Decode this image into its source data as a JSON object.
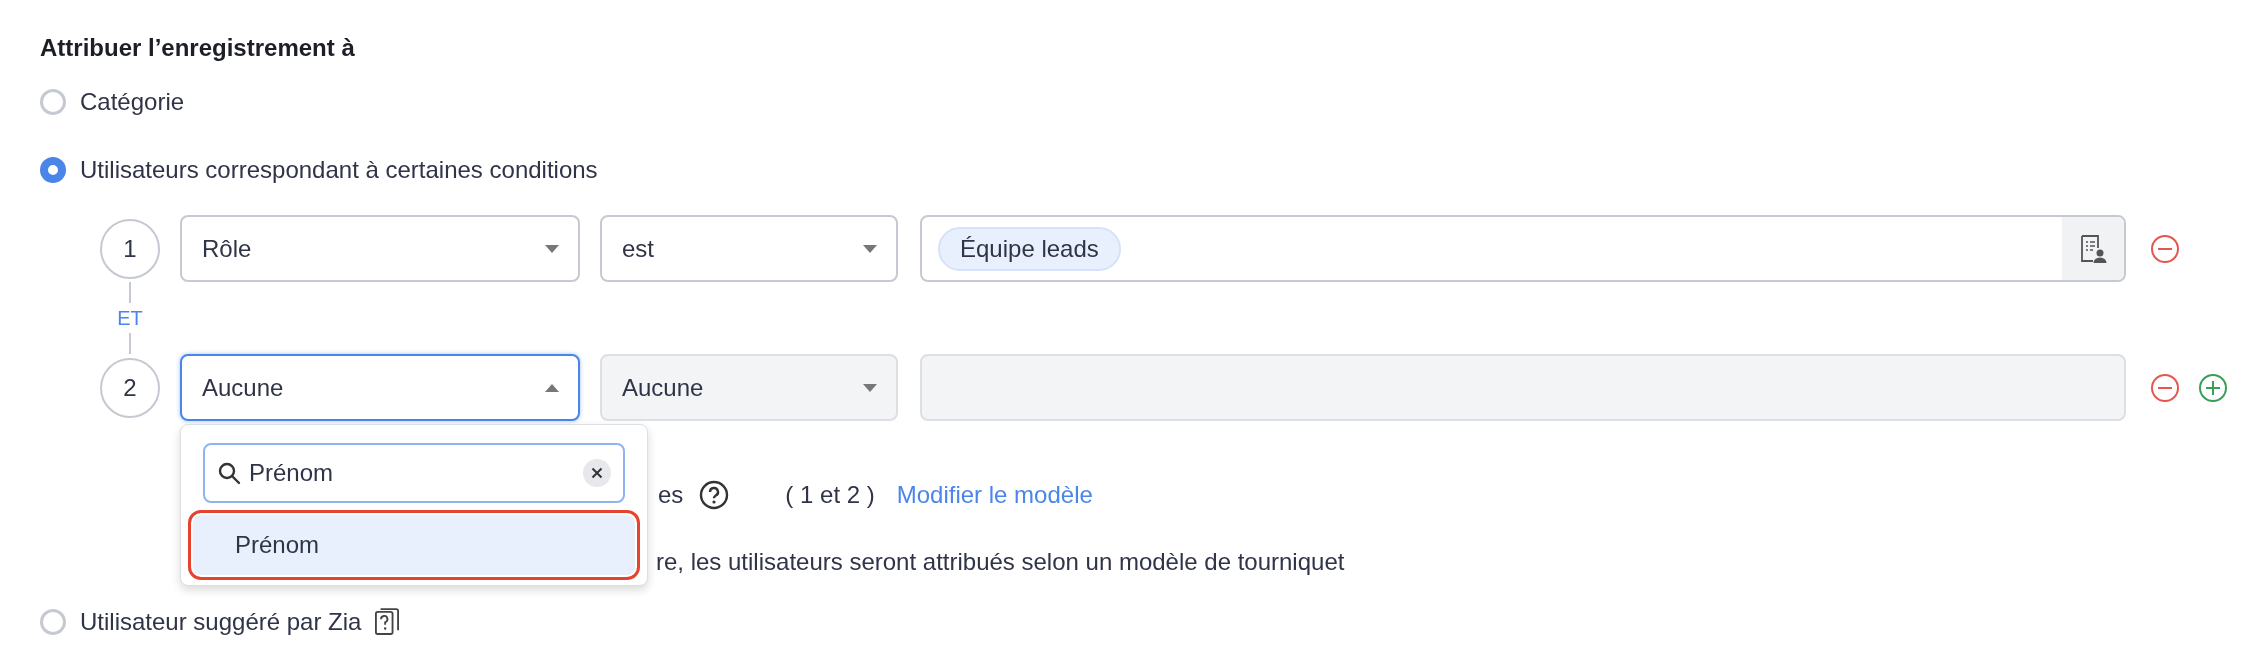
{
  "heading": "Attribuer l’enregistrement à",
  "options": [
    {
      "label": "Catégorie",
      "selected": false
    },
    {
      "label": "Utilisateurs correspondant à certaines conditions",
      "selected": true
    },
    {
      "label": "Utilisateur suggéré par Zia",
      "selected": false
    }
  ],
  "conditions": [
    {
      "number": "1",
      "field": "Rôle",
      "operator": "est",
      "values": [
        "Équipe leads"
      ],
      "disabled": false,
      "expanded": false,
      "can_add": false
    },
    {
      "number": "2",
      "field": "Aucune",
      "operator": "Aucune",
      "disabled": true,
      "expanded": true,
      "can_add": true
    }
  ],
  "connector": "ET",
  "dropdown": {
    "search": "Prénom",
    "options": [
      {
        "label": "Prénom",
        "selected": true
      }
    ]
  },
  "pattern": {
    "label": "es",
    "criteria": "( 1 et 2 )",
    "link": "Modifier le modèle"
  },
  "note": "re, les utilisateurs seront attribués selon un modèle de tourniquet"
}
